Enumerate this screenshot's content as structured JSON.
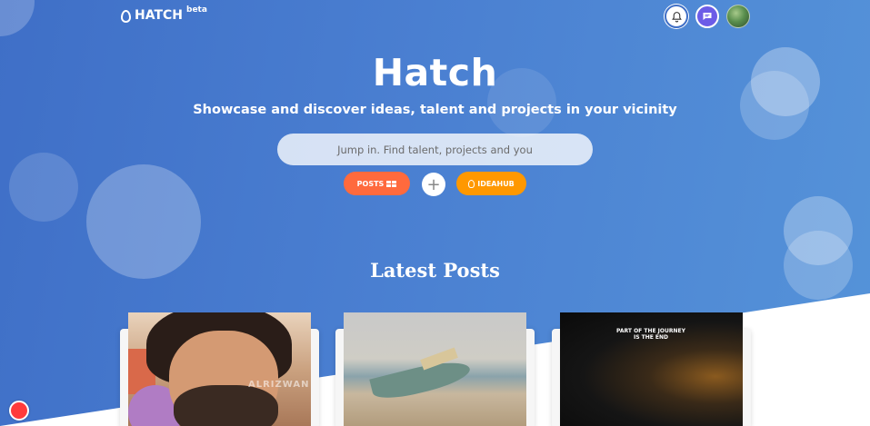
{
  "brand": {
    "name": "HATCH",
    "badge": "beta"
  },
  "hero": {
    "title": "Hatch",
    "subtitle": "Showcase and discover ideas, talent and projects in your vicinity"
  },
  "search": {
    "placeholder": "Jump in. Find talent, projects and you",
    "value": ""
  },
  "actions": {
    "posts_label": "POSTS",
    "ideahub_label": "IDEAHUB",
    "add_symbol": "+"
  },
  "header_icons": [
    "bell-icon",
    "chat-icon",
    "user-avatar"
  ],
  "section": {
    "latest_posts": "Latest Posts"
  },
  "posts": [
    {
      "kind": "illustration-portrait",
      "watermark": "ALRIZWAN"
    },
    {
      "kind": "beach-boat-photo"
    },
    {
      "kind": "dark-portrait-quote",
      "quote": "PART OF THE JOURNEY IS THE END"
    }
  ],
  "colors": {
    "hero_start": "#3f6fc7",
    "hero_end": "#5593d9",
    "posts_button": "#ff6a3d",
    "ideahub_button": "#ff9800",
    "chat_button": "#6c5ce7",
    "notification": "#ff3b3b"
  }
}
